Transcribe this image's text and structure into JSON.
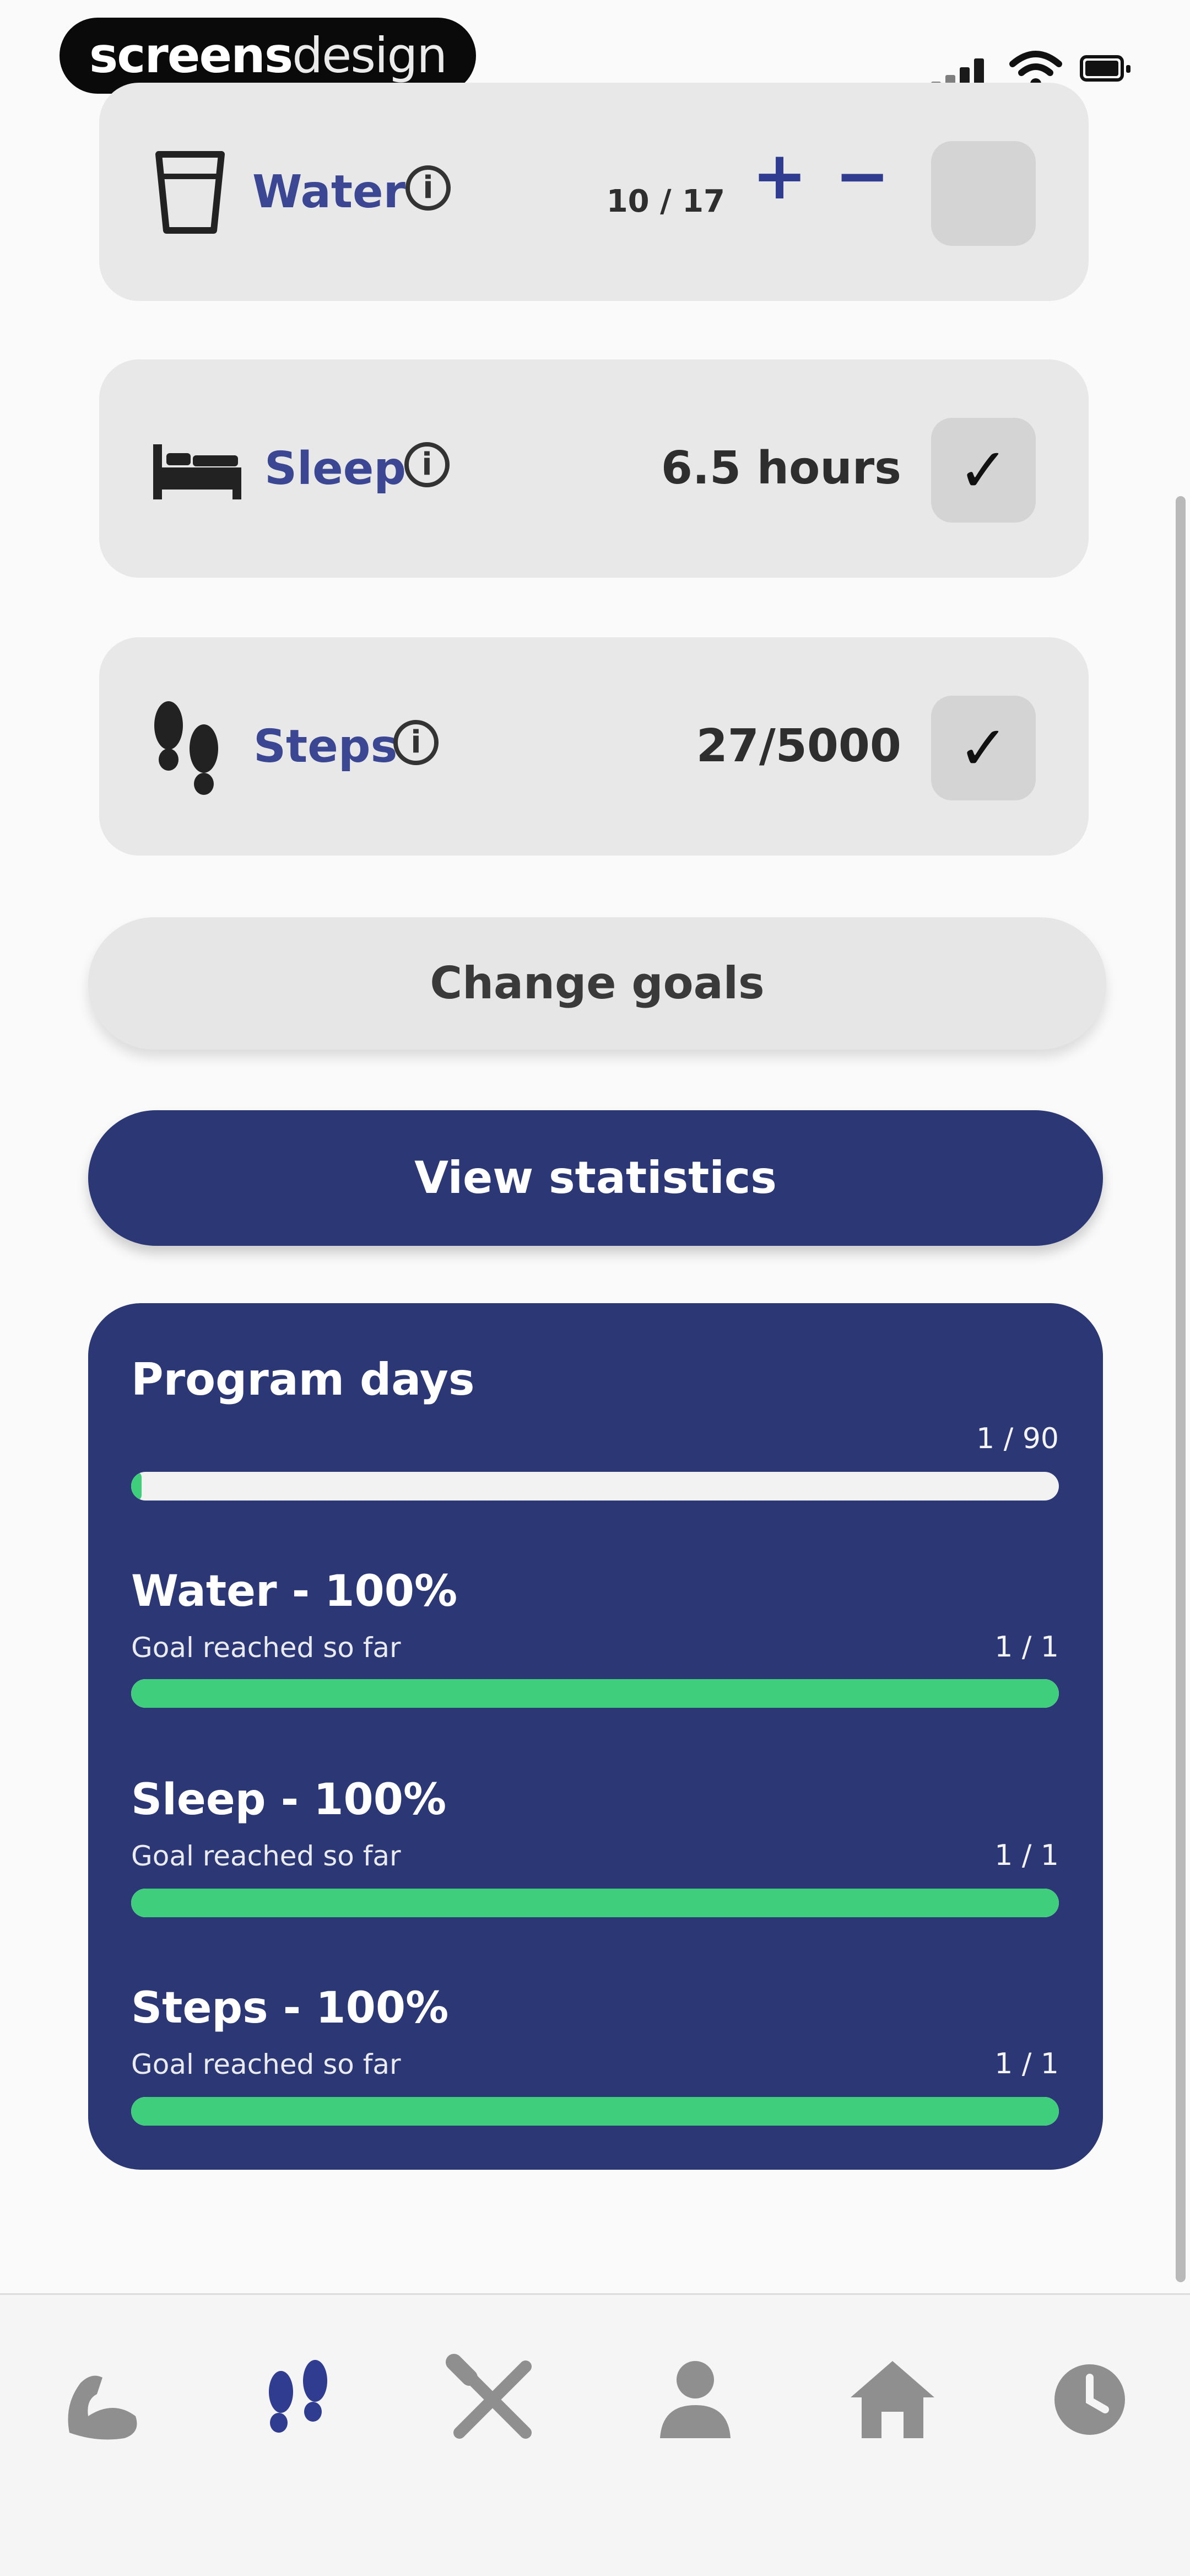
{
  "status_bar": {
    "brand_bold": "screens",
    "brand_light": "design"
  },
  "goals": [
    {
      "label": "Water",
      "value": "10 / 17",
      "icon": "water-cup-icon",
      "checked": false,
      "stepper": {
        "plus": "+",
        "minus": "−"
      }
    },
    {
      "label": "Sleep",
      "value": "6.5 hours",
      "icon": "bed-icon",
      "checked": true
    },
    {
      "label": "Steps",
      "value": "27/5000",
      "icon": "footprints-icon",
      "checked": true
    }
  ],
  "info_glyph": "i",
  "check_glyph": "✓",
  "buttons": {
    "change_goals": "Change goals",
    "view_statistics": "View statistics"
  },
  "progress": {
    "title": "Program days",
    "program_count": "1 / 90",
    "program_fraction": 0.011,
    "rows": [
      {
        "title": "Water - 100%",
        "subtitle": "Goal reached so far",
        "count": "1 / 1",
        "fraction": 1.0
      },
      {
        "title": "Sleep - 100%",
        "subtitle": "Goal reached so far",
        "count": "1 / 1",
        "fraction": 1.0
      },
      {
        "title": "Steps - 100%",
        "subtitle": "Goal reached so far",
        "count": "1 / 1",
        "fraction": 1.0
      }
    ]
  },
  "colors": {
    "accent": "#2b3875",
    "progress_green": "#3fcf7c",
    "card_bg": "#e8e8e8",
    "nav_active": "#2f3c8f",
    "nav_inactive": "#8f8f8f"
  },
  "bottom_nav": [
    {
      "icon": "muscle-arm-icon",
      "active": false
    },
    {
      "icon": "footprints-icon",
      "active": true
    },
    {
      "icon": "utensils-icon",
      "active": false
    },
    {
      "icon": "person-icon",
      "active": false
    },
    {
      "icon": "home-icon",
      "active": false
    },
    {
      "icon": "history-icon",
      "active": false
    }
  ]
}
